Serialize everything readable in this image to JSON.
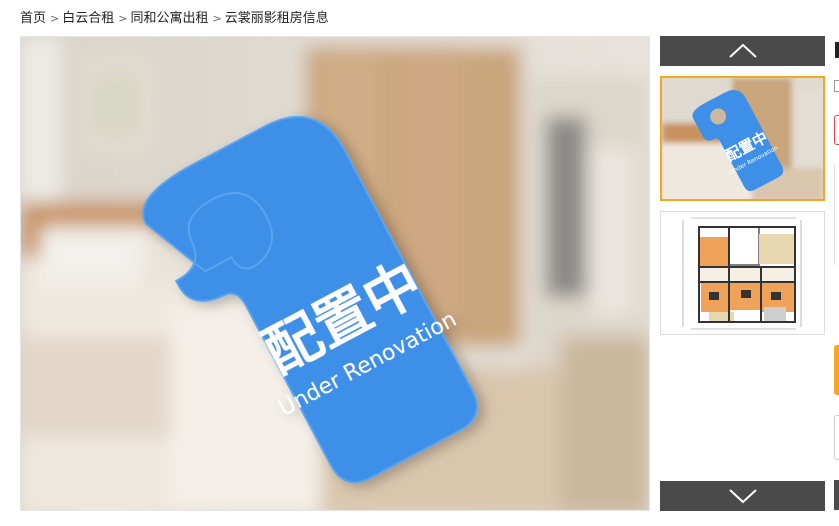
{
  "breadcrumb": {
    "items": [
      "首页",
      "白云合租",
      "同和公寓出租",
      "云裳丽影租房信息"
    ],
    "separator": ">"
  },
  "main_photo": {
    "tag_title": "配置中",
    "tag_subtitle": "Under Renovation",
    "tag_color": "#3d8fe8"
  },
  "thumbnails": {
    "up_icon": "chevron-up-icon",
    "down_icon": "chevron-down-icon",
    "active_border_color": "#f5a623",
    "items": [
      {
        "tag_title": "配置中",
        "tag_subtitle": "Under Renovation"
      },
      {
        "kind": "floor-plan"
      }
    ]
  },
  "colors": {
    "rail_button": "#4a4a4a",
    "accent_orange": "#f5a623"
  }
}
